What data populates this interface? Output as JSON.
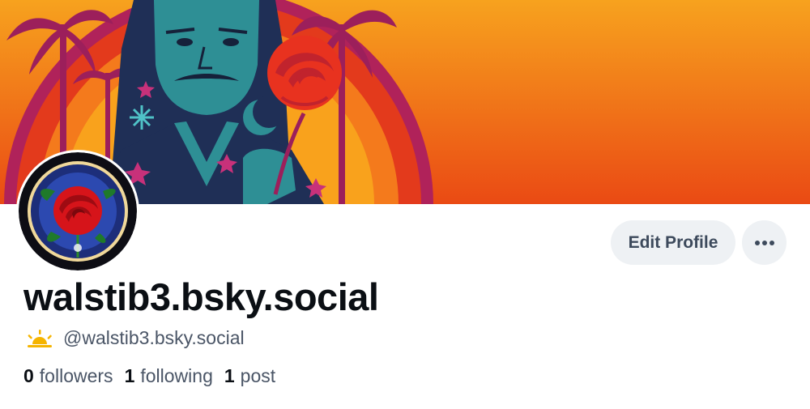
{
  "profile": {
    "display_name": "walstib3.bsky.social",
    "handle": "@walstib3.bsky.social",
    "handle_badge_icon": "sun-horizon-icon",
    "followers_count": "0",
    "followers_label": "followers",
    "following_count": "1",
    "following_label": "following",
    "posts_count": "1",
    "posts_label": "post"
  },
  "actions": {
    "edit_profile_label": "Edit Profile",
    "more_icon": "ellipsis-icon"
  },
  "colors": {
    "banner_orange": "#f7901e",
    "banner_red": "#e8421a",
    "teal": "#2e8f95",
    "navy": "#1f2f56",
    "button_bg": "#eef1f4",
    "button_text": "#3d4a5c",
    "name_text": "#0b0f14",
    "muted_text": "#4a5566"
  }
}
